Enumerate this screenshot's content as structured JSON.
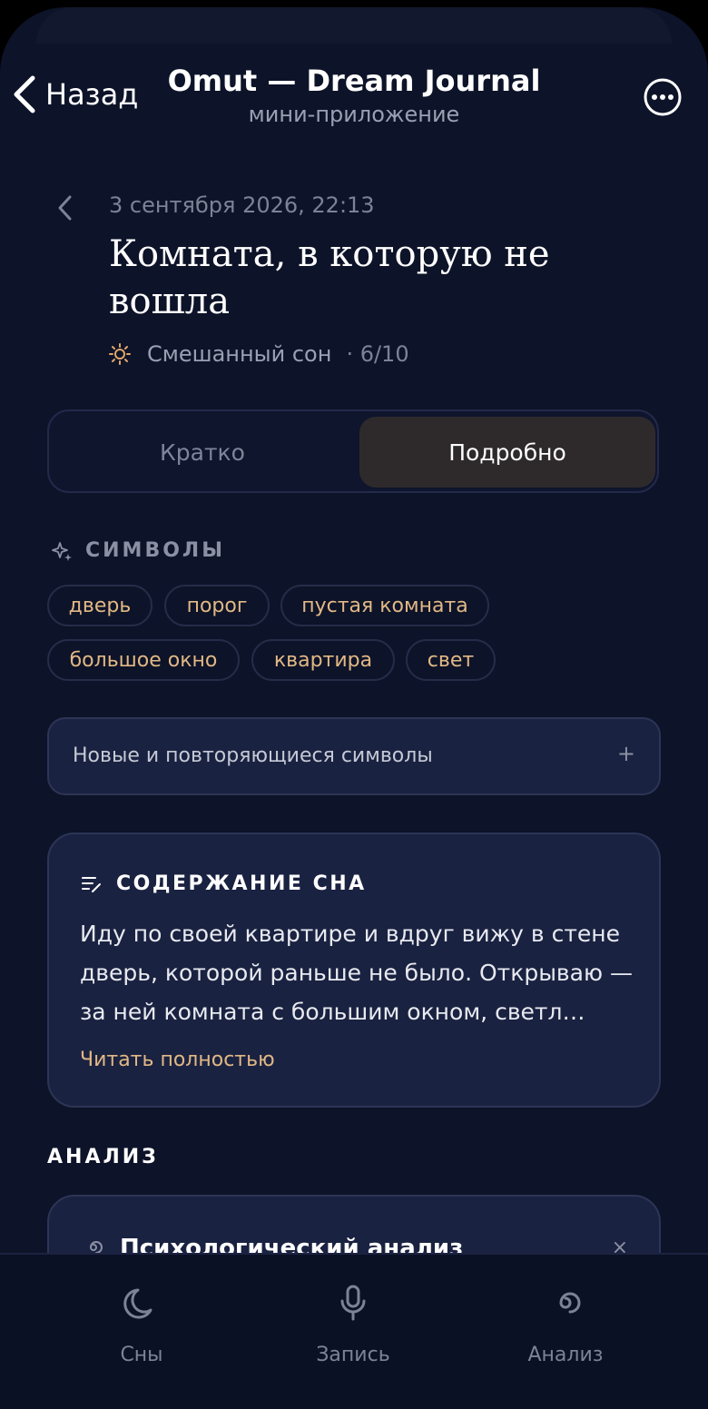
{
  "header": {
    "back_label": "Назад",
    "title": "Omut — Dream Journal",
    "subtitle": "мини-приложение"
  },
  "dream": {
    "date": "3 сентября 2026, 22:13",
    "title": "Комната, в которую не вошла",
    "type": "Смешанный сон",
    "score": "· 6/10"
  },
  "segment": {
    "options": [
      "Кратко",
      "Подробно"
    ],
    "selected": "Подробно"
  },
  "symbols": {
    "heading": "СИМВОЛЫ",
    "chips": [
      "дверь",
      "порог",
      "пустая комната",
      "большое окно",
      "квартира",
      "свет"
    ]
  },
  "accordion": {
    "label": "Новые и повторяющиеся символы",
    "toggle": "+"
  },
  "content_card": {
    "heading": "СОДЕРЖАНИЕ СНА",
    "text": "Иду по своей квартире и вдруг вижу в стене дверь, которой раньше не было. Открываю — за ней комната с большим окном, светл…",
    "read_more": "Читать полностью"
  },
  "analysis": {
    "heading": "АНАЛИЗ",
    "card_title": "Психологический анализ",
    "close": "×"
  },
  "tabbar": {
    "tabs": [
      "Сны",
      "Запись",
      "Анализ"
    ]
  },
  "colors": {
    "background": "#0d1328",
    "card": "#1a2241",
    "accent": "#e1b885"
  }
}
